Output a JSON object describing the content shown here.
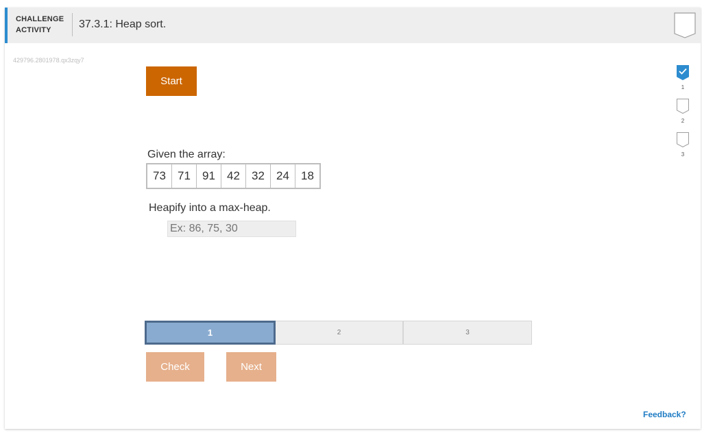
{
  "header": {
    "label_line1": "CHALLENGE",
    "label_line2": "ACTIVITY",
    "title": "37.3.1: Heap sort."
  },
  "activity_id": "429796.2801978.qx3zqy7",
  "start_label": "Start",
  "levels": [
    {
      "number": "1",
      "completed": true
    },
    {
      "number": "2",
      "completed": false
    },
    {
      "number": "3",
      "completed": false
    }
  ],
  "question": {
    "given_label": "Given the array:",
    "array": [
      "73",
      "71",
      "91",
      "42",
      "32",
      "24",
      "18"
    ],
    "prompt": "Heapify into a max-heap.",
    "answer_value": "",
    "answer_placeholder": "Ex: 86, 75, 30"
  },
  "progress": {
    "steps": [
      "1",
      "2",
      "3"
    ],
    "current": 1
  },
  "buttons": {
    "check": "Check",
    "next": "Next"
  },
  "feedback_label": "Feedback?",
  "colors": {
    "accent": "#2d8ccf",
    "start_button": "#cc6600",
    "disabled_button": "#e6b08c",
    "active_step": "#8aabd0",
    "active_step_border": "#4d6a8c",
    "link": "#1f7cc4"
  }
}
